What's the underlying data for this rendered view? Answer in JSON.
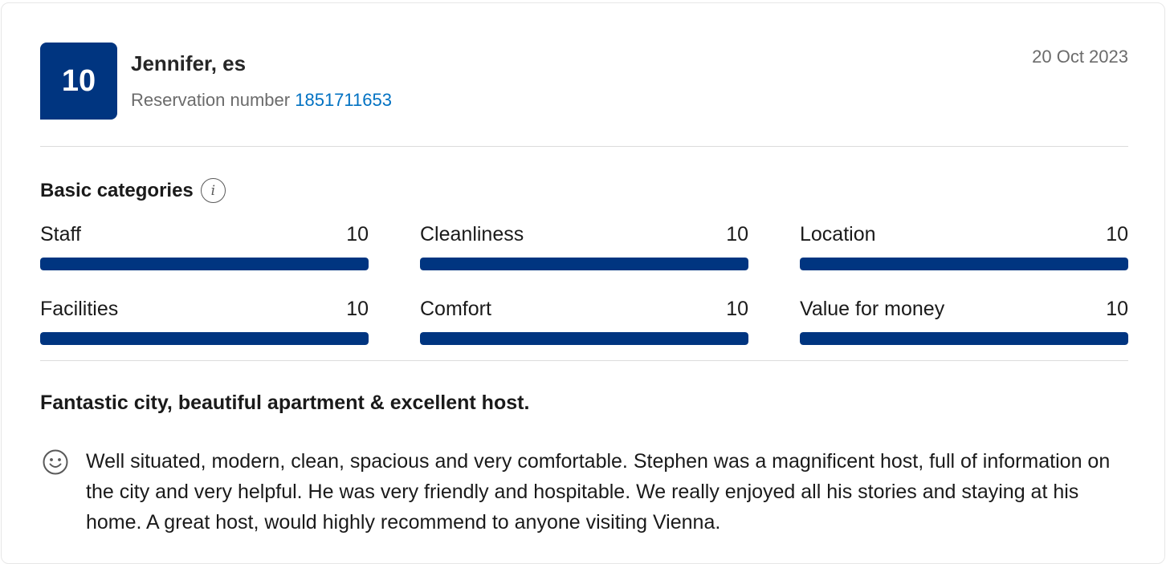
{
  "review": {
    "score": "10",
    "reviewer": "Jennifer, es",
    "reservation_label": "Reservation number",
    "reservation_number": "1851711653",
    "date": "20 Oct 2023"
  },
  "categories_title": "Basic categories",
  "info_icon": "info-icon",
  "categories": [
    {
      "label": "Staff",
      "score": "10",
      "fill": 1.0
    },
    {
      "label": "Cleanliness",
      "score": "10",
      "fill": 1.0
    },
    {
      "label": "Location",
      "score": "10",
      "fill": 1.0
    },
    {
      "label": "Facilities",
      "score": "10",
      "fill": 1.0
    },
    {
      "label": "Comfort",
      "score": "10",
      "fill": 1.0
    },
    {
      "label": "Value for money",
      "score": "10",
      "fill": 1.0
    }
  ],
  "headline": "Fantastic city, beautiful apartment & excellent host.",
  "positive_icon": "smile-icon",
  "positive_text": "Well situated, modern, clean, spacious and very comfortable. Stephen was a magnificent host, full of information on the city and very helpful. He was very friendly and hospitable. We really enjoyed all his stories and staying at his home. A great host, would highly recommend to anyone visiting Vienna.",
  "colors": {
    "brand_blue": "#003580",
    "link_blue": "#0071c2",
    "muted_text": "#6b6b6b"
  }
}
